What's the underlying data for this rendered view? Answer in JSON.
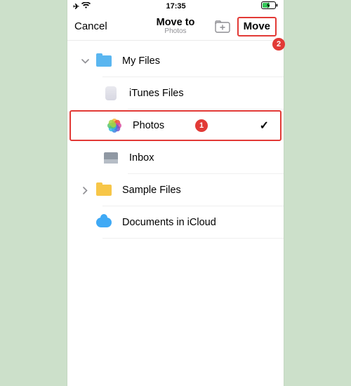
{
  "status": {
    "time": "17:35"
  },
  "nav": {
    "cancel": "Cancel",
    "title": "Move to",
    "subtitle": "Photos",
    "move": "Move"
  },
  "annotations": {
    "move_badge": "2",
    "photos_badge": "1"
  },
  "rows": {
    "myfiles": "My Files",
    "itunes": "iTunes Files",
    "photos": "Photos",
    "inbox": "Inbox",
    "sample": "Sample Files",
    "icloud": "Documents in iCloud"
  }
}
